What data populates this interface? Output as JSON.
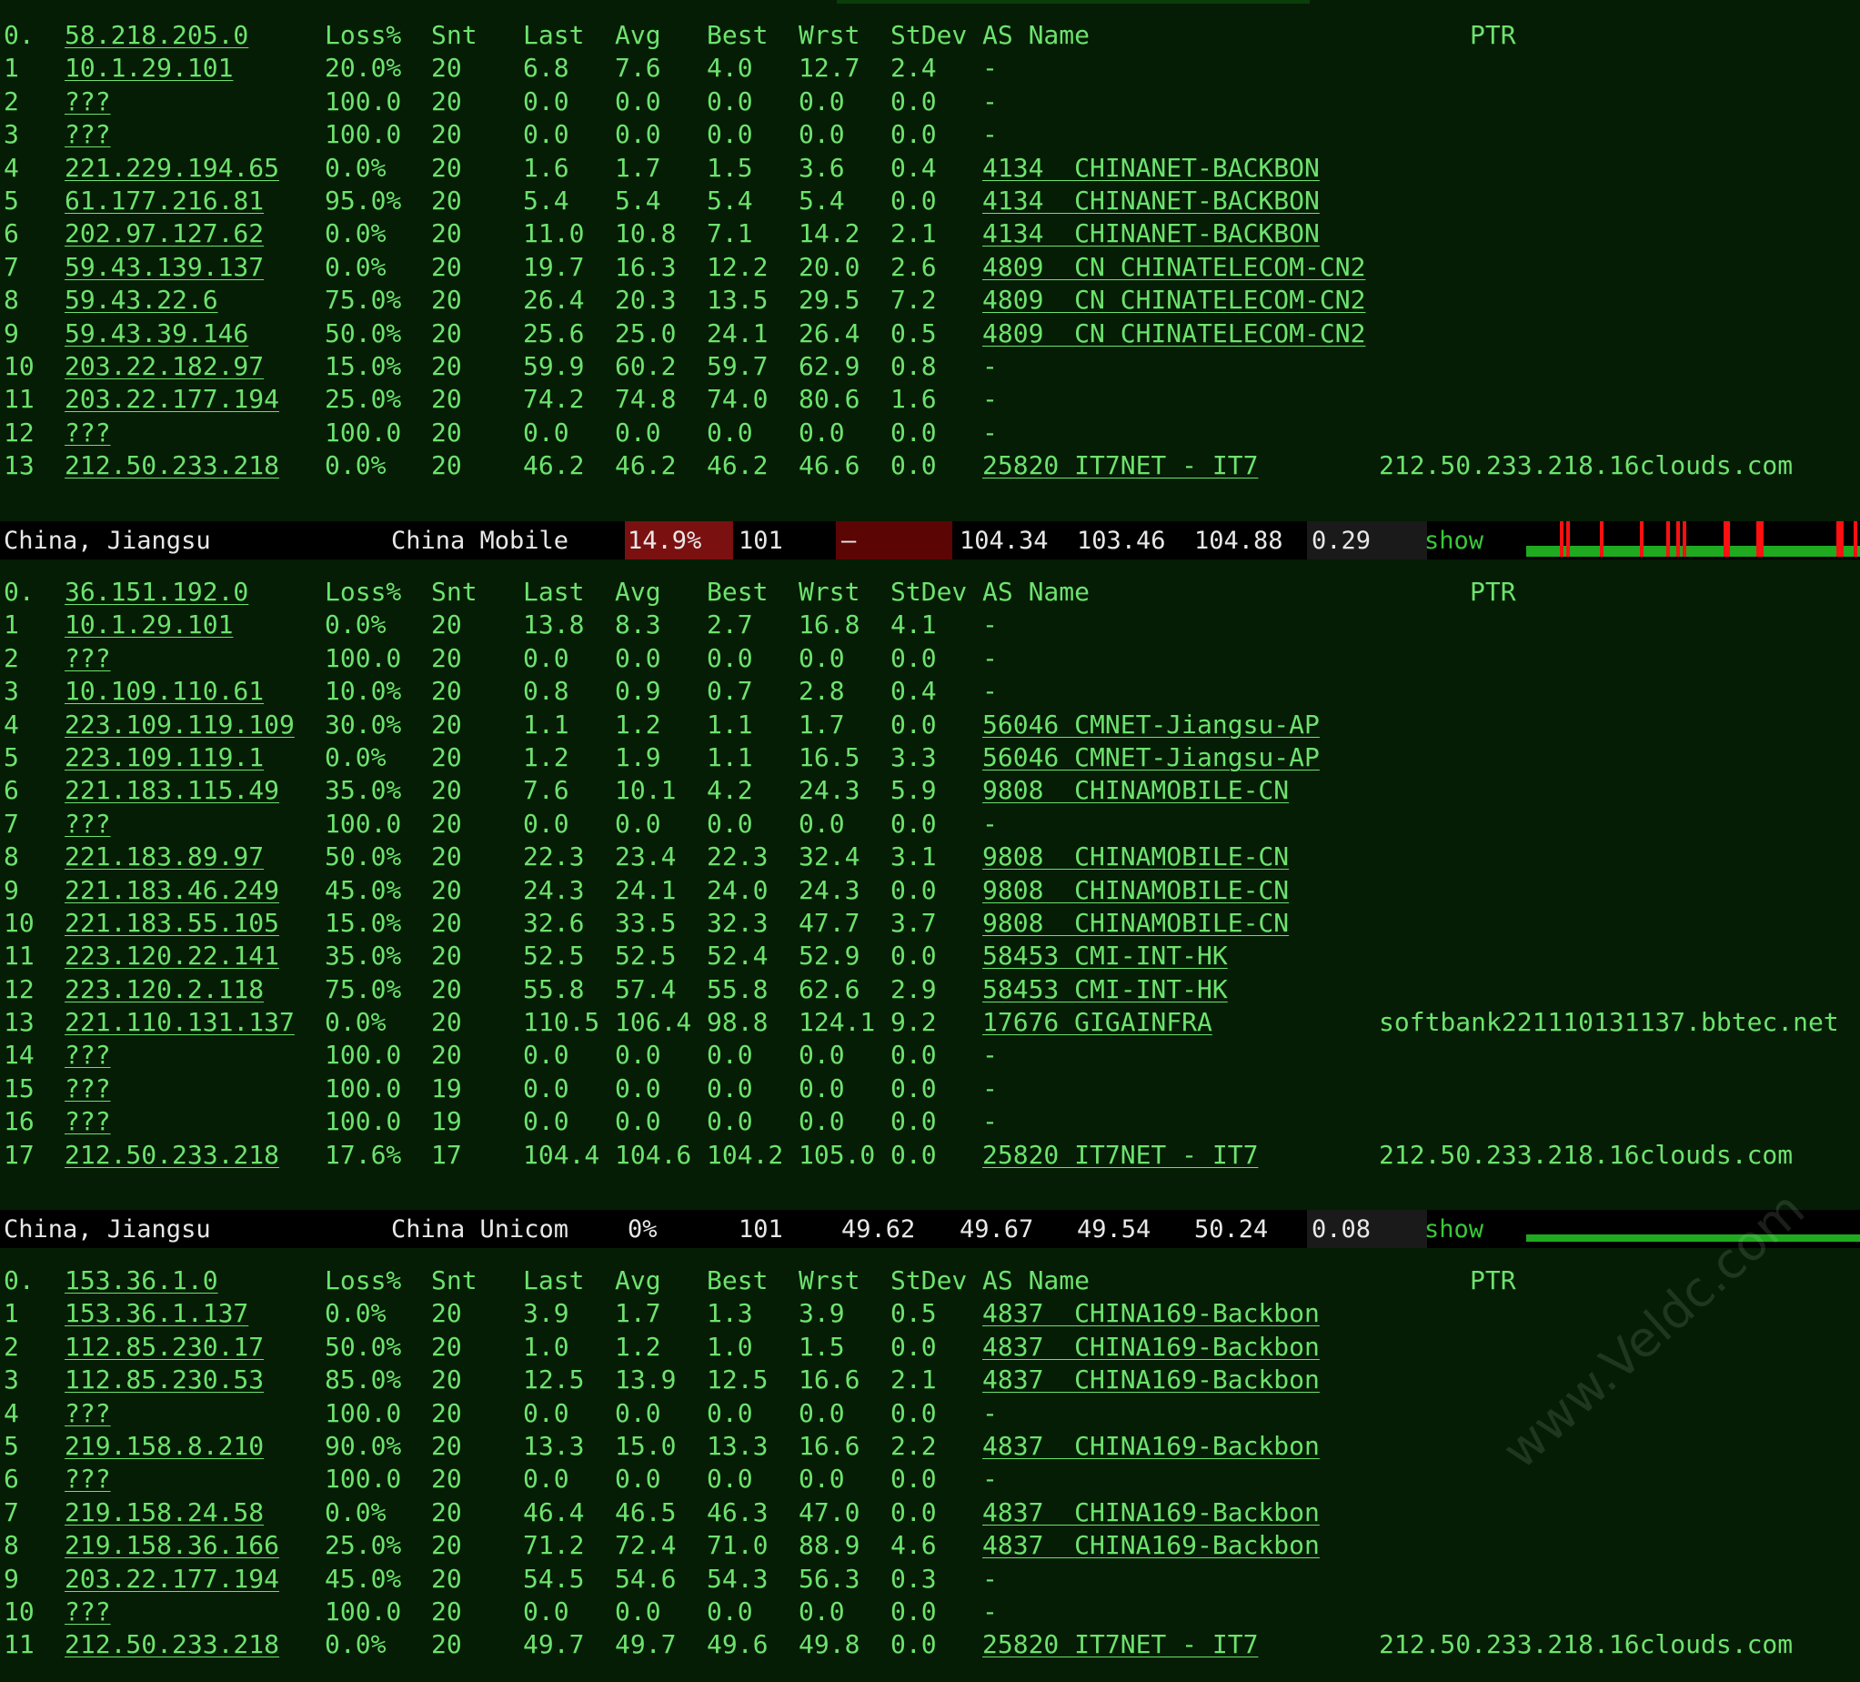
{
  "headers": {
    "loss": "Loss%",
    "snt": "Snt",
    "last": "Last",
    "avg": "Avg",
    "best": "Best",
    "wrst": "Wrst",
    "stdev": "StDev",
    "as": "AS Name",
    "ptr": "PTR"
  },
  "traces": [
    {
      "head_hop": "0.",
      "head_ip": "58.218.205.0",
      "hops": [
        [
          "1",
          "10.1.29.101",
          "20.0%",
          "20",
          "6.8",
          "7.6",
          "4.0",
          "12.7",
          "2.4",
          "-",
          ""
        ],
        [
          "2",
          "???",
          "100.0",
          "20",
          "0.0",
          "0.0",
          "0.0",
          "0.0",
          "0.0",
          "-",
          ""
        ],
        [
          "3",
          "???",
          "100.0",
          "20",
          "0.0",
          "0.0",
          "0.0",
          "0.0",
          "0.0",
          "-",
          ""
        ],
        [
          "4",
          "221.229.194.65",
          "0.0%",
          "20",
          "1.6",
          "1.7",
          "1.5",
          "3.6",
          "0.4",
          "4134  CHINANET-BACKBON",
          ""
        ],
        [
          "5",
          "61.177.216.81",
          "95.0%",
          "20",
          "5.4",
          "5.4",
          "5.4",
          "5.4",
          "0.0",
          "4134  CHINANET-BACKBON",
          ""
        ],
        [
          "6",
          "202.97.127.62",
          "0.0%",
          "20",
          "11.0",
          "10.8",
          "7.1",
          "14.2",
          "2.1",
          "4134  CHINANET-BACKBON",
          ""
        ],
        [
          "7",
          "59.43.139.137",
          "0.0%",
          "20",
          "19.7",
          "16.3",
          "12.2",
          "20.0",
          "2.6",
          "4809  CN CHINATELECOM-CN2",
          ""
        ],
        [
          "8",
          "59.43.22.6",
          "75.0%",
          "20",
          "26.4",
          "20.3",
          "13.5",
          "29.5",
          "7.2",
          "4809  CN CHINATELECOM-CN2",
          ""
        ],
        [
          "9",
          "59.43.39.146",
          "50.0%",
          "20",
          "25.6",
          "25.0",
          "24.1",
          "26.4",
          "0.5",
          "4809  CN CHINATELECOM-CN2",
          ""
        ],
        [
          "10",
          "203.22.182.97",
          "15.0%",
          "20",
          "59.9",
          "60.2",
          "59.7",
          "62.9",
          "0.8",
          "-",
          ""
        ],
        [
          "11",
          "203.22.177.194",
          "25.0%",
          "20",
          "74.2",
          "74.8",
          "74.0",
          "80.6",
          "1.6",
          "-",
          ""
        ],
        [
          "12",
          "???",
          "100.0",
          "20",
          "0.0",
          "0.0",
          "0.0",
          "0.0",
          "0.0",
          "-",
          ""
        ],
        [
          "13",
          "212.50.233.218",
          "0.0%",
          "20",
          "46.2",
          "46.2",
          "46.2",
          "46.6",
          "0.0",
          "25820 IT7NET - IT7",
          "212.50.233.218.16clouds.com"
        ]
      ]
    },
    {
      "head_hop": "0.",
      "head_ip": "36.151.192.0",
      "hops": [
        [
          "1",
          "10.1.29.101",
          "0.0%",
          "20",
          "13.8",
          "8.3",
          "2.7",
          "16.8",
          "4.1",
          "-",
          ""
        ],
        [
          "2",
          "???",
          "100.0",
          "20",
          "0.0",
          "0.0",
          "0.0",
          "0.0",
          "0.0",
          "-",
          ""
        ],
        [
          "3",
          "10.109.110.61",
          "10.0%",
          "20",
          "0.8",
          "0.9",
          "0.7",
          "2.8",
          "0.4",
          "-",
          ""
        ],
        [
          "4",
          "223.109.119.109",
          "30.0%",
          "20",
          "1.1",
          "1.2",
          "1.1",
          "1.7",
          "0.0",
          "56046 CMNET-Jiangsu-AP",
          ""
        ],
        [
          "5",
          "223.109.119.1",
          "0.0%",
          "20",
          "1.2",
          "1.9",
          "1.1",
          "16.5",
          "3.3",
          "56046 CMNET-Jiangsu-AP",
          ""
        ],
        [
          "6",
          "221.183.115.49",
          "35.0%",
          "20",
          "7.6",
          "10.1",
          "4.2",
          "24.3",
          "5.9",
          "9808  CHINAMOBILE-CN",
          ""
        ],
        [
          "7",
          "???",
          "100.0",
          "20",
          "0.0",
          "0.0",
          "0.0",
          "0.0",
          "0.0",
          "-",
          ""
        ],
        [
          "8",
          "221.183.89.97",
          "50.0%",
          "20",
          "22.3",
          "23.4",
          "22.3",
          "32.4",
          "3.1",
          "9808  CHINAMOBILE-CN",
          ""
        ],
        [
          "9",
          "221.183.46.249",
          "45.0%",
          "20",
          "24.3",
          "24.1",
          "24.0",
          "24.3",
          "0.0",
          "9808  CHINAMOBILE-CN",
          ""
        ],
        [
          "10",
          "221.183.55.105",
          "15.0%",
          "20",
          "32.6",
          "33.5",
          "32.3",
          "47.7",
          "3.7",
          "9808  CHINAMOBILE-CN",
          ""
        ],
        [
          "11",
          "223.120.22.141",
          "35.0%",
          "20",
          "52.5",
          "52.5",
          "52.4",
          "52.9",
          "0.0",
          "58453 CMI-INT-HK",
          ""
        ],
        [
          "12",
          "223.120.2.118",
          "75.0%",
          "20",
          "55.8",
          "57.4",
          "55.8",
          "62.6",
          "2.9",
          "58453 CMI-INT-HK",
          ""
        ],
        [
          "13",
          "221.110.131.137",
          "0.0%",
          "20",
          "110.5",
          "106.4",
          "98.8",
          "124.1",
          "9.2",
          "17676 GIGAINFRA",
          "softbank221110131137.bbtec.net"
        ],
        [
          "14",
          "???",
          "100.0",
          "20",
          "0.0",
          "0.0",
          "0.0",
          "0.0",
          "0.0",
          "-",
          ""
        ],
        [
          "15",
          "???",
          "100.0",
          "19",
          "0.0",
          "0.0",
          "0.0",
          "0.0",
          "0.0",
          "-",
          ""
        ],
        [
          "16",
          "???",
          "100.0",
          "19",
          "0.0",
          "0.0",
          "0.0",
          "0.0",
          "0.0",
          "-",
          ""
        ],
        [
          "17",
          "212.50.233.218",
          "17.6%",
          "17",
          "104.4",
          "104.6",
          "104.2",
          "105.0",
          "0.0",
          "25820 IT7NET - IT7",
          "212.50.233.218.16clouds.com"
        ]
      ]
    },
    {
      "head_hop": "0.",
      "head_ip": "153.36.1.0",
      "hops": [
        [
          "1",
          "153.36.1.137",
          "0.0%",
          "20",
          "3.9",
          "1.7",
          "1.3",
          "3.9",
          "0.5",
          "4837  CHINA169-Backbon",
          ""
        ],
        [
          "2",
          "112.85.230.17",
          "50.0%",
          "20",
          "1.0",
          "1.2",
          "1.0",
          "1.5",
          "0.0",
          "4837  CHINA169-Backbon",
          ""
        ],
        [
          "3",
          "112.85.230.53",
          "85.0%",
          "20",
          "12.5",
          "13.9",
          "12.5",
          "16.6",
          "2.1",
          "4837  CHINA169-Backbon",
          ""
        ],
        [
          "4",
          "???",
          "100.0",
          "20",
          "0.0",
          "0.0",
          "0.0",
          "0.0",
          "0.0",
          "-",
          ""
        ],
        [
          "5",
          "219.158.8.210",
          "90.0%",
          "20",
          "13.3",
          "15.0",
          "13.3",
          "16.6",
          "2.2",
          "4837  CHINA169-Backbon",
          ""
        ],
        [
          "6",
          "???",
          "100.0",
          "20",
          "0.0",
          "0.0",
          "0.0",
          "0.0",
          "0.0",
          "-",
          ""
        ],
        [
          "7",
          "219.158.24.58",
          "0.0%",
          "20",
          "46.4",
          "46.5",
          "46.3",
          "47.0",
          "0.0",
          "4837  CHINA169-Backbon",
          ""
        ],
        [
          "8",
          "219.158.36.166",
          "25.0%",
          "20",
          "71.2",
          "72.4",
          "71.0",
          "88.9",
          "4.6",
          "4837  CHINA169-Backbon",
          ""
        ],
        [
          "9",
          "203.22.177.194",
          "45.0%",
          "20",
          "54.5",
          "54.6",
          "54.3",
          "56.3",
          "0.3",
          "-",
          ""
        ],
        [
          "10",
          "???",
          "100.0",
          "20",
          "0.0",
          "0.0",
          "0.0",
          "0.0",
          "0.0",
          "-",
          ""
        ],
        [
          "11",
          "212.50.233.218",
          "0.0%",
          "20",
          "49.7",
          "49.7",
          "49.6",
          "49.8",
          "0.0",
          "25820 IT7NET - IT7",
          "212.50.233.218.16clouds.com"
        ]
      ]
    }
  ],
  "summaries": [
    {
      "location": "China, Jiangsu",
      "isp": "China Mobile",
      "loss": "14.9%",
      "sent": "101",
      "last": "–",
      "avg": "104.34",
      "best": "103.46",
      "worst": "104.88",
      "stdev": "0.29",
      "action": "show",
      "loss_flag": true,
      "spark_loss": [
        0.1,
        0.12,
        0.22,
        0.34,
        0.42,
        0.45,
        0.47,
        0.59,
        0.6,
        0.69,
        0.7,
        0.93,
        0.98
      ]
    },
    {
      "location": "China, Jiangsu",
      "isp": "China Unicom",
      "loss": "0%",
      "sent": "101",
      "last": "49.62",
      "avg": "49.67",
      "best": "49.54",
      "worst": "50.24",
      "stdev": "0.08",
      "action": "show",
      "loss_flag": false,
      "spark_loss": []
    }
  ],
  "watermark": "www.Veldc.com",
  "colors": {
    "bg": "#041d04",
    "text": "#6ee26e",
    "spark_ok": "#1faa1f",
    "spark_loss": "#ff1010"
  }
}
